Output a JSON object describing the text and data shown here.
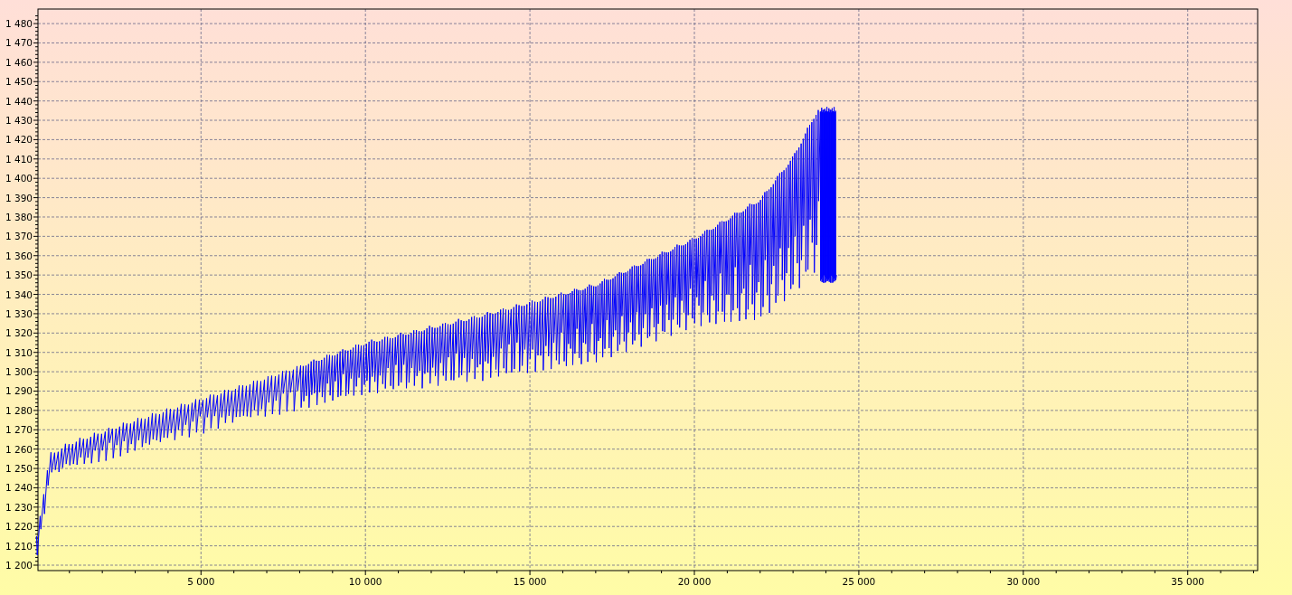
{
  "chart": {
    "y_axis_labels": [
      "1 480",
      "1 470",
      "1 460",
      "1 450",
      "1 440",
      "1 430",
      "1 420",
      "1 410",
      "1 400",
      "1 390",
      "1 380",
      "1 370",
      "1 360",
      "1 350",
      "1 340",
      "1 330",
      "1 320",
      "1 310",
      "1 300",
      "1 290",
      "1 280",
      "1 270",
      "1 260",
      "1 250",
      "1 240",
      "1 230",
      "1 220",
      "1 210",
      "1 200"
    ],
    "x_axis_labels": [
      "5 000",
      "10 000",
      "15 000",
      "20 000",
      "25 000",
      "30 000",
      "35 000"
    ]
  }
}
